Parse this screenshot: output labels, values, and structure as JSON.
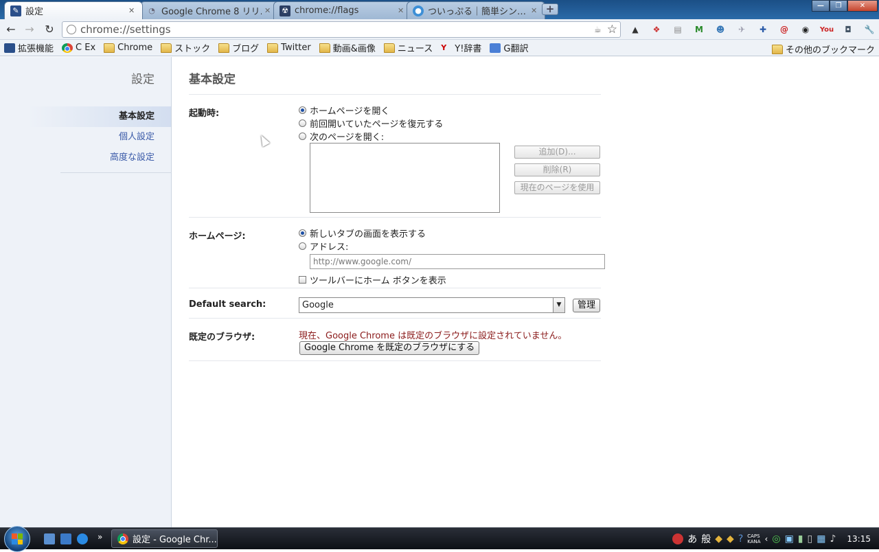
{
  "tabs": [
    {
      "title": "設定",
      "icon": "wrench-icon"
    },
    {
      "title": "Google Chrome 8 リリ…",
      "icon": "rss-icon"
    },
    {
      "title": "chrome://flags",
      "icon": "flags-icon"
    },
    {
      "title": "ついっぷる｜簡単シン…",
      "icon": "tweet-icon"
    }
  ],
  "new_tab_label": "+",
  "window_controls": {
    "minimize": "—",
    "maximize": "❐",
    "close": "✕"
  },
  "toolbar": {
    "back": "←",
    "forward": "→",
    "reload": "↻",
    "url": "chrome://settings",
    "star": "☆",
    "wrench": "🔧"
  },
  "extensions": [
    "bird",
    "buttons",
    "badge",
    "gmail",
    "person",
    "send",
    "tool",
    "at",
    "color",
    "you10",
    "camera"
  ],
  "bookmarks": [
    {
      "label": "拡張機能",
      "icon": "puzzle"
    },
    {
      "label": "C Ex",
      "icon": "chrome"
    },
    {
      "label": "Chrome",
      "icon": "folder"
    },
    {
      "label": "ストック",
      "icon": "folder"
    },
    {
      "label": "ブログ",
      "icon": "folder"
    },
    {
      "label": "Twitter",
      "icon": "folder"
    },
    {
      "label": "動画&画像",
      "icon": "folder"
    },
    {
      "label": "ニュース",
      "icon": "folder"
    },
    {
      "label": "Y!辞書",
      "icon": "yahoo"
    },
    {
      "label": "G翻訳",
      "icon": "translate"
    }
  ],
  "bookmarks_other": "その他のブックマーク",
  "sidebar": {
    "title": "設定",
    "items": [
      "基本設定",
      "個人設定",
      "高度な設定"
    ],
    "selected": 0
  },
  "main": {
    "title": "基本設定",
    "startup": {
      "label": "起動時:",
      "options": [
        "ホームページを開く",
        "前回開いていたページを復元する",
        "次のページを開く:"
      ],
      "selected": 0,
      "buttons": {
        "add": "追加(D)...",
        "remove": "削除(R)",
        "use_current": "現在のページを使用"
      }
    },
    "homepage": {
      "label": "ホームページ:",
      "options": [
        "新しいタブの画面を表示する",
        "アドレス:"
      ],
      "selected": 0,
      "url_placeholder": "http://www.google.com/",
      "show_home_button": "ツールバーにホーム ボタンを表示",
      "show_home_checked": false
    },
    "default_search": {
      "label": "Default search:",
      "value": "Google",
      "manage": "管理"
    },
    "default_browser": {
      "label": "既定のブラウザ:",
      "status": "現在、Google Chrome は既定のブラウザに設定されていません。",
      "button": "Google Chrome を既定のブラウザにする"
    }
  },
  "taskbar": {
    "active_task": "設定 - Google Chr...",
    "ime_a": "あ",
    "ime_mode": "般",
    "caps": "CAPS",
    "kana": "KANA",
    "clock": "13:15"
  }
}
